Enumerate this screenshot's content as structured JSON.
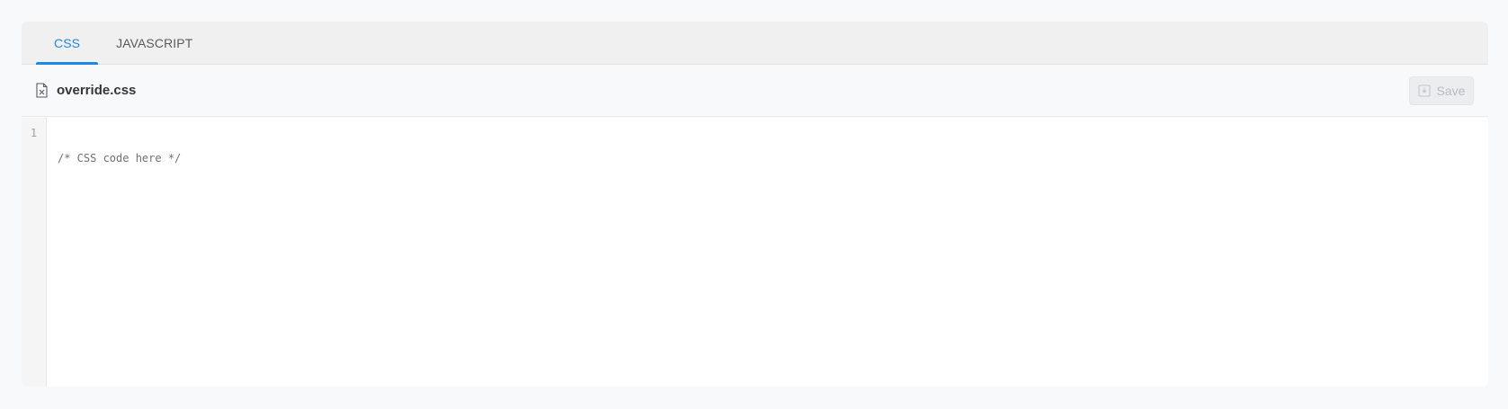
{
  "tabs": [
    {
      "label": "CSS",
      "active": true
    },
    {
      "label": "JAVASCRIPT",
      "active": false
    }
  ],
  "file": {
    "name": "override.css",
    "icon": "file-x-icon"
  },
  "toolbar": {
    "save_label": "Save",
    "save_icon": "save-icon",
    "save_enabled": false
  },
  "editor": {
    "lines": [
      {
        "number": "1",
        "text": "/* CSS code here */"
      }
    ]
  },
  "colors": {
    "accent": "#1e88e5",
    "tab_text": "#555b61",
    "code_text": "#6b7177"
  }
}
